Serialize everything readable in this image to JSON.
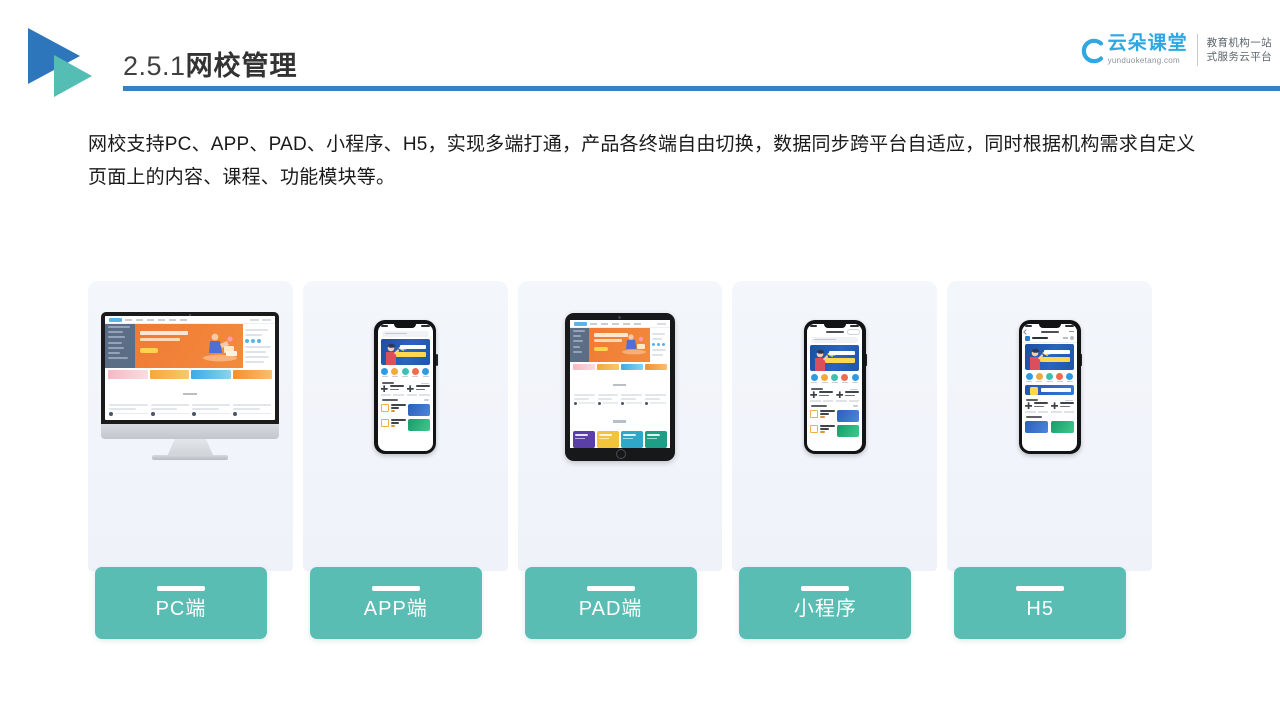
{
  "header": {
    "section_number": "2.5.1",
    "title": "网校管理",
    "accent_color": "#3A7FBF",
    "logo_blue": "#2E76BC",
    "logo_teal": "#54BDB4"
  },
  "brand": {
    "name": "云朵课堂",
    "url": "yunduoketang.com",
    "tagline_line1": "教育机构一站",
    "tagline_line2": "式服务云平台",
    "color": "#2FA7E0"
  },
  "body": {
    "paragraph": "网校支持PC、APP、PAD、小程序、H5，实现多端打通，产品各终端自由切换，数据同步跨平台自适应，同时根据机构需求自定义页面上的内容、课程、功能模块等。"
  },
  "cards": [
    {
      "label": "PC端",
      "device": "desktop-monitor"
    },
    {
      "label": "APP端",
      "device": "smartphone"
    },
    {
      "label": "PAD端",
      "device": "tablet"
    },
    {
      "label": "小程序",
      "device": "smartphone-miniprogram"
    },
    {
      "label": "H5",
      "device": "smartphone-browser"
    }
  ],
  "theme": {
    "label_bg": "#59BDB4",
    "card_bg": "#F2F5FB",
    "text_color": "#1a1a1a"
  }
}
